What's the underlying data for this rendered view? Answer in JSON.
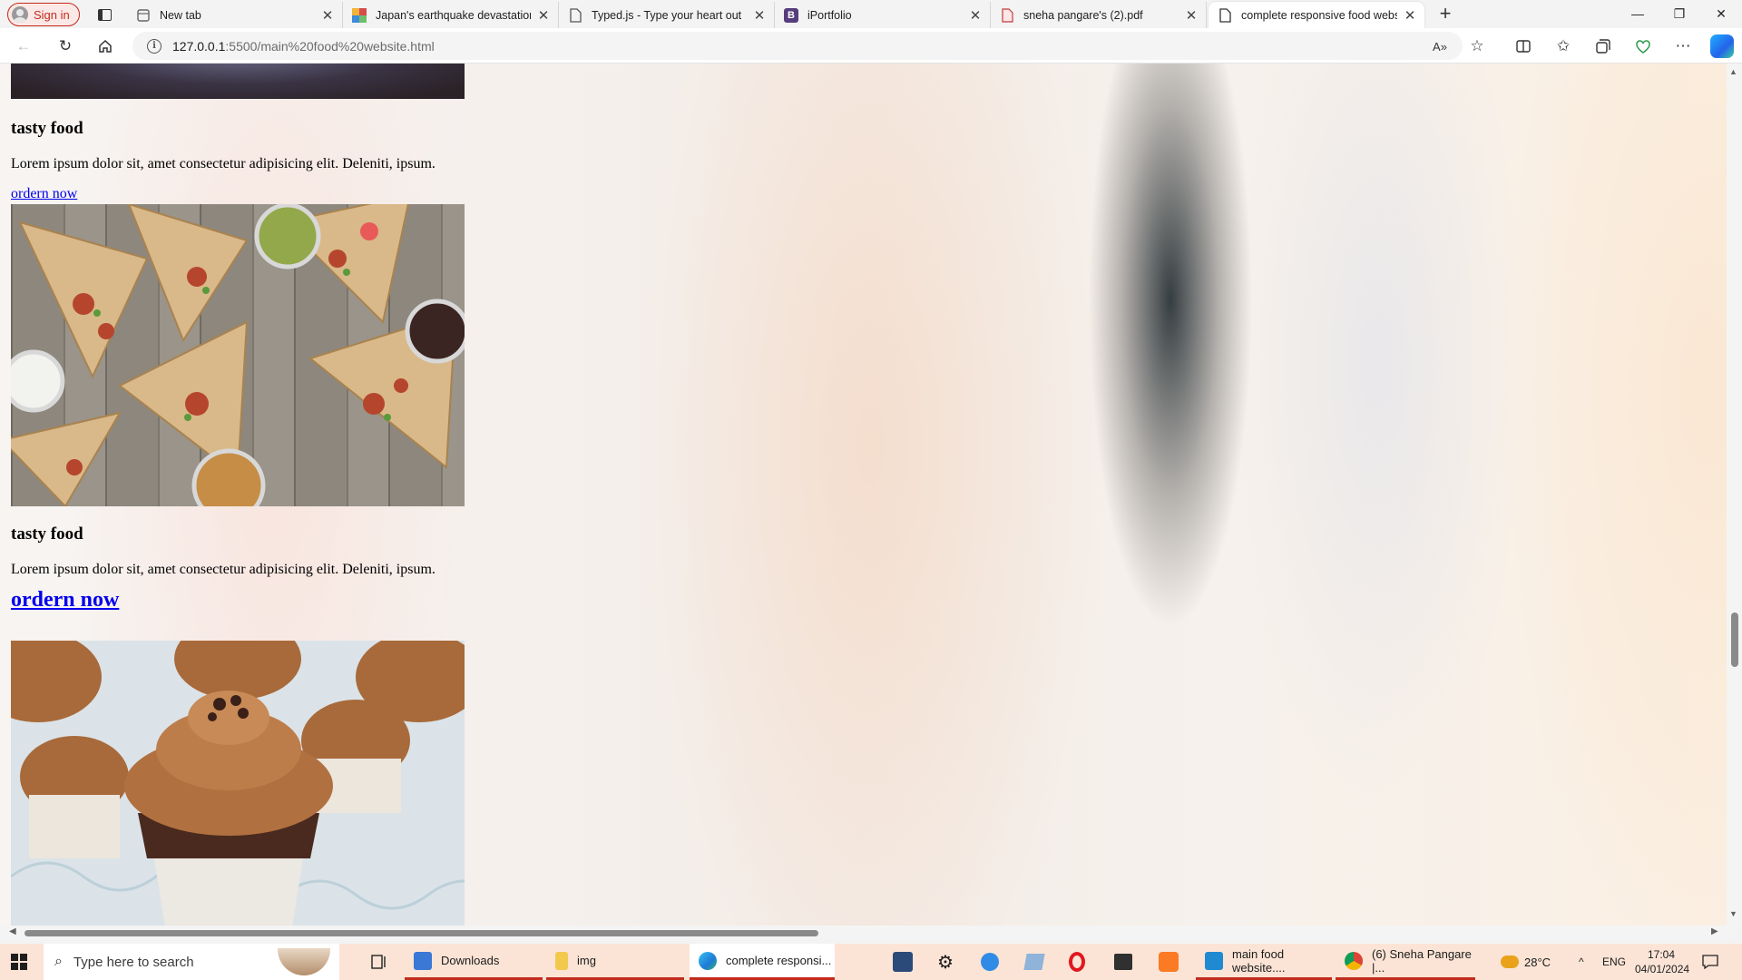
{
  "browser": {
    "profile_label": "Sign in",
    "tabs": [
      {
        "title": "New tab",
        "icon": "page-icon"
      },
      {
        "title": "Japan's earthquake devastation c",
        "icon": "news-favicon"
      },
      {
        "title": "Typed.js - Type your heart out",
        "icon": "page-icon"
      },
      {
        "title": "iPortfolio",
        "icon": "bootstrap-favicon",
        "glyph": "B"
      },
      {
        "title": "sneha pangare's (2).pdf",
        "icon": "pdf-icon"
      },
      {
        "title": "complete responsive food websi",
        "icon": "page-icon",
        "active": true
      }
    ],
    "new_tab_glyph": "+",
    "url_host": "127.0.0.1",
    "url_rest": ":5500/main%20food%20website.html",
    "accent_color": "#c42b1c"
  },
  "page": {
    "cards": [
      {
        "title": "tasty food",
        "text": "Lorem ipsum dolor sit, amet consectetur adipisicing elit. Deleniti, ipsum.",
        "link": "ordern now"
      },
      {
        "title": "tasty food",
        "text": "Lorem ipsum dolor sit, amet consectetur adipisicing elit. Deleniti, ipsum.",
        "link": "ordern now"
      }
    ],
    "images": [
      "wraps-photo",
      "cupcakes-photo"
    ]
  },
  "taskbar": {
    "search_placeholder": "Type here to search",
    "apps": [
      {
        "label": "Downloads",
        "icon": "downloads-folder-icon"
      },
      {
        "label": "img",
        "icon": "folder-icon"
      },
      {
        "label": "complete responsi...",
        "icon": "edge-icon"
      },
      {
        "label": "main food website....",
        "icon": "vscode-icon"
      },
      {
        "label": "(6) Sneha Pangare |...",
        "icon": "chrome-icon"
      }
    ],
    "weather": "28°C",
    "language": "ENG",
    "time": "17:04",
    "date": "04/01/2024"
  }
}
